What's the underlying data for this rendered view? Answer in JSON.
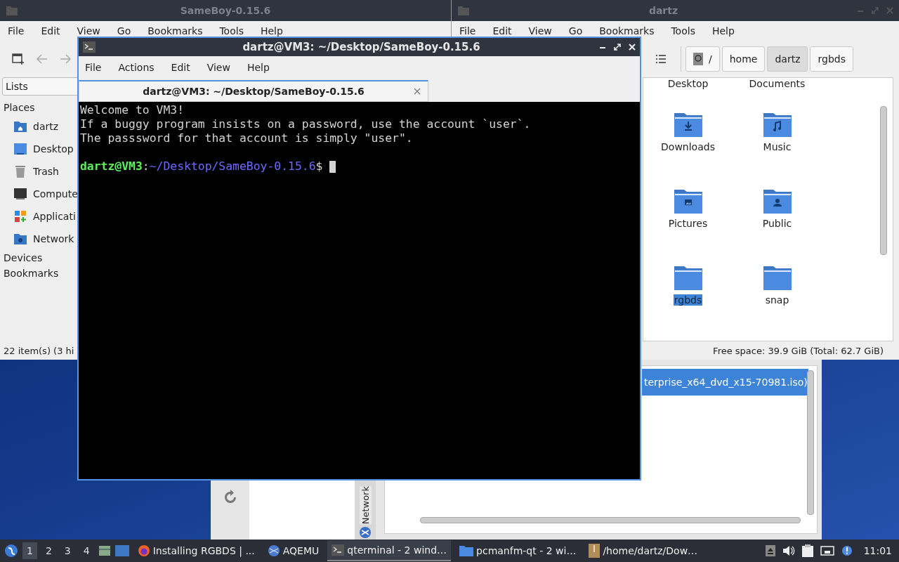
{
  "left_file_manager": {
    "title": "SameBoy-0.15.6",
    "menu": [
      "File",
      "Edit",
      "View",
      "Go",
      "Bookmarks",
      "Tools",
      "Help"
    ],
    "panel_mode": "Lists",
    "sections": [
      {
        "label": "Places",
        "items": [
          {
            "label": "dartz",
            "kind": "home"
          },
          {
            "label": "Desktop",
            "kind": "desktop"
          },
          {
            "label": "Trash",
            "kind": "trash"
          },
          {
            "label": "Compute",
            "kind": "computer"
          },
          {
            "label": "Applicati",
            "kind": "apps"
          },
          {
            "label": "Network",
            "kind": "network"
          }
        ]
      },
      {
        "label": "Devices"
      },
      {
        "label": "Bookmarks"
      }
    ],
    "status": "22 item(s) (3 hi"
  },
  "right_file_manager": {
    "title": "dartz",
    "menu": [
      "File",
      "Edit",
      "View",
      "Go",
      "Bookmarks",
      "Tools",
      "Help"
    ],
    "path": [
      {
        "label": "/",
        "selected": false
      },
      {
        "label": "home",
        "selected": false
      },
      {
        "label": "dartz",
        "selected": true
      },
      {
        "label": "rgbds",
        "selected": false
      }
    ],
    "items": [
      {
        "label": "Desktop",
        "kind": "cut",
        "selected": false
      },
      {
        "label": "Documents",
        "kind": "cut",
        "selected": false
      },
      {
        "label": "Downloads",
        "kind": "downloads",
        "selected": false
      },
      {
        "label": "Music",
        "kind": "music",
        "selected": false
      },
      {
        "label": "Pictures",
        "kind": "pictures",
        "selected": false
      },
      {
        "label": "Public",
        "kind": "public",
        "selected": false
      },
      {
        "label": "rgbds",
        "kind": "plain",
        "selected": true
      },
      {
        "label": "snap",
        "kind": "plain",
        "selected": false
      }
    ],
    "status": "Free space: 39.9 GiB (Total: 62.7 GiB)"
  },
  "emulator_window": {
    "side_tab": "Network",
    "rows": [
      {
        "label": "terprise_x64_dvd_x15-70981.iso)",
        "selected": true
      }
    ]
  },
  "terminal": {
    "title": "dartz@VM3: ~/Desktop/SameBoy-0.15.6",
    "menu": [
      "File",
      "Actions",
      "Edit",
      "View",
      "Help"
    ],
    "tabs": [
      {
        "label": "dartz@VM3: ~/Desktop/SameBoy-0.15.6",
        "selected": true
      }
    ],
    "lines": [
      "Welcome to VM3!",
      "If a buggy program insists on a password, use the account `user`.",
      "The passsword for that account is simply \"user\"."
    ],
    "prompt": {
      "user_host": "dartz@VM3",
      "separator": ":",
      "path": "~/Desktop/SameBoy-0.15.6",
      "symbol": "$"
    }
  },
  "taskbar": {
    "workspaces": [
      {
        "label": "1",
        "selected": true
      },
      {
        "label": "2",
        "selected": false
      },
      {
        "label": "3",
        "selected": false
      },
      {
        "label": "4",
        "selected": false
      }
    ],
    "tasks": [
      {
        "label": "Installing RGBDS | ...",
        "kind": "browser",
        "selected": false
      },
      {
        "label": "AQEMU",
        "kind": "emulator",
        "selected": false
      },
      {
        "label": "qterminal - 2 wind…",
        "kind": "terminal",
        "selected": true
      },
      {
        "label": "pcmanfm-qt - 2 wi…",
        "kind": "folder",
        "selected": false
      },
      {
        "label": "/home/dartz/Dow…",
        "kind": "archive",
        "selected": false
      }
    ],
    "clock": "11:01"
  }
}
